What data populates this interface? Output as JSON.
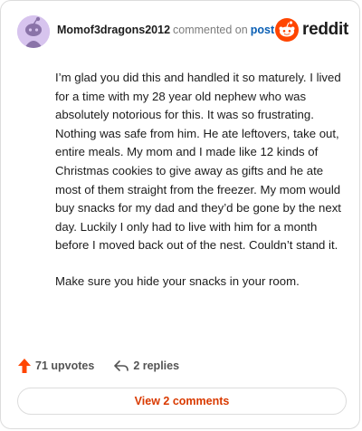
{
  "comment": {
    "username": "Momof3dragons2012",
    "action": "commented on",
    "link": "post",
    "paragraphs": [
      "I’m glad you did this and handled it so maturely. I lived for a time with my 28 year old nephew who was absolutely notorious for this. It was so frustrating. Nothing was safe from him. He ate leftovers, take out, entire meals. My mom and I made like 12 kinds of Christmas cookies to give away as gifts and he ate most of them straight from the freezer. My mom would buy snacks for my dad and they’d be gone by the next day. Luckily I only had to live with him for a month before I moved back out of the nest. Couldn’t stand it.",
      "Make sure you hide your snacks in your room."
    ],
    "upvotes": "71 upvotes",
    "replies": "2 replies",
    "view_comments": "View 2 comments"
  },
  "brand": {
    "name": "reddit"
  },
  "icons": {
    "avatar": "snoo-avatar",
    "brand": "reddit-logo-icon",
    "upvote": "upvote-arrow-icon",
    "reply": "reply-arrow-icon"
  },
  "colors": {
    "brand_orange": "#ff4500",
    "upvote": "#ff4500",
    "link_blue": "#0a5fb4",
    "view_comments_text": "#d93a00",
    "avatar_bg": "#d7c4ee"
  }
}
